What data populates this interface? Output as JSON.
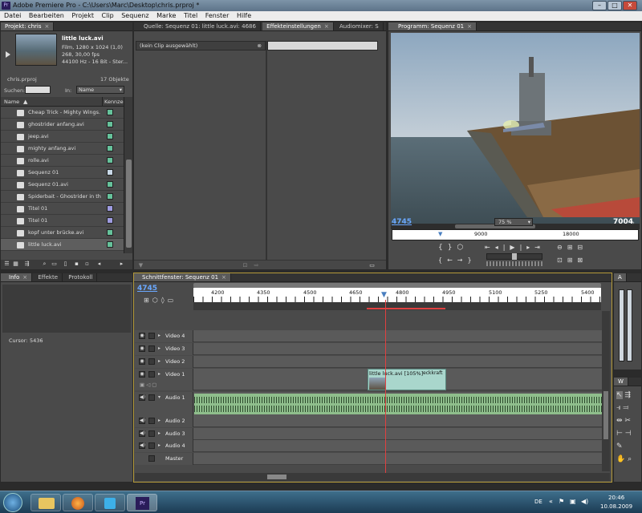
{
  "window": {
    "title": "Adobe Premiere Pro - C:\\Users\\Marc\\Desktop\\chris.prproj *",
    "logo": "Pr",
    "min_icon": "minimize-icon",
    "max_icon": "maximize-icon",
    "close_icon": "close-icon"
  },
  "menu": [
    "Datei",
    "Bearbeiten",
    "Projekt",
    "Clip",
    "Sequenz",
    "Marke",
    "Titel",
    "Fenster",
    "Hilfe"
  ],
  "project": {
    "tab": "Projekt: chris",
    "clip_name": "little luck.avi",
    "clip_info": [
      "Film, 1280 x 1024 (1,0)",
      "268, 30,00 fps",
      "44100 Hz - 16 Bit - Ster..."
    ],
    "file": "chris.prproj",
    "count": "17 Objekte",
    "search_label": "Suchen:",
    "in_label": "In:",
    "in_value": "Name",
    "col_name": "Name",
    "col_label": "Kennzei",
    "items": [
      {
        "name": "Cheap Trick - Mighty Wings.",
        "icon": "audio-icon",
        "color": "#66c29b"
      },
      {
        "name": "ghostrider anfang.avi",
        "icon": "film-icon",
        "color": "#66c29b"
      },
      {
        "name": "jeep.avi",
        "icon": "film-icon",
        "color": "#66c29b"
      },
      {
        "name": "mighty anfang.avi",
        "icon": "film-icon",
        "color": "#66c29b"
      },
      {
        "name": "rolle.avi",
        "icon": "film-icon",
        "color": "#66c29b"
      },
      {
        "name": "Sequenz 01",
        "icon": "sequence-icon",
        "color": "#c9d9e8"
      },
      {
        "name": "Sequenz 01.avi",
        "icon": "film-icon",
        "color": "#66c29b"
      },
      {
        "name": "Spiderbait - Ghostrider in th",
        "icon": "audio-icon",
        "color": "#66c29b"
      },
      {
        "name": "Titel 01",
        "icon": "title-icon",
        "color": "#9e9be0"
      },
      {
        "name": "Titel 01",
        "icon": "title-icon",
        "color": "#9e9be0"
      },
      {
        "name": "kopf unter brücke.avi",
        "icon": "film-icon",
        "color": "#66c29b"
      },
      {
        "name": "little luck.avi",
        "icon": "film-icon",
        "color": "#66c29b"
      }
    ]
  },
  "source": {
    "tabs": [
      "Quelle: Sequenz 01: little luck.avi: 4686",
      "Effekteinstellungen",
      "Audiomixer: S"
    ],
    "no_clip": "(kein Clip ausgewählt)"
  },
  "program": {
    "tab": "Programm: Sequenz 01",
    "timecode": "4745",
    "zoom": "75 %",
    "duration": "7004",
    "ruler": [
      "9000",
      "18000"
    ]
  },
  "info": {
    "tabs": [
      "Info",
      "Effekte",
      "Protokoll"
    ],
    "cursor_label": "Cursor:",
    "cursor_value": "5436"
  },
  "timeline": {
    "tab": "Schnittfenster: Sequenz 01",
    "timecode": "4745",
    "ruler": [
      "4200",
      "4350",
      "4500",
      "4650",
      "4800",
      "4950",
      "5100",
      "5250",
      "5400"
    ],
    "tracks": [
      "Video 4",
      "Video 3",
      "Video 2",
      "Video 1",
      "Audio 1",
      "Audio 2",
      "Audio 3",
      "Audio 4",
      "Master"
    ],
    "clip_label": "little luck.avi [105%]",
    "clip_effect": "eckkraft"
  },
  "tools_tab": "W",
  "audio_tab": "A",
  "taskbar": {
    "lang": "DE",
    "time": "20:46",
    "date": "10.08.2009",
    "apps": [
      "start-orb-icon",
      "explorer-icon",
      "firefox-icon",
      "vista-app-icon",
      "premiere-icon"
    ]
  }
}
